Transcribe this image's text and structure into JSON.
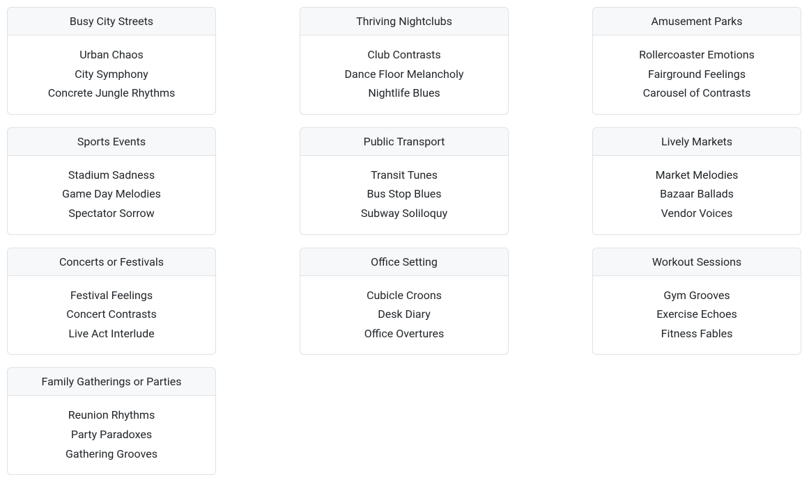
{
  "cards": [
    {
      "title": "Busy City Streets",
      "items": [
        "Urban Chaos",
        "City Symphony",
        "Concrete Jungle Rhythms"
      ]
    },
    {
      "title": "Thriving Nightclubs",
      "items": [
        "Club Contrasts",
        "Dance Floor Melancholy",
        "Nightlife Blues"
      ]
    },
    {
      "title": "Amusement Parks",
      "items": [
        "Rollercoaster Emotions",
        "Fairground Feelings",
        "Carousel of Contrasts"
      ]
    },
    {
      "title": "Sports Events",
      "items": [
        "Stadium Sadness",
        "Game Day Melodies",
        "Spectator Sorrow"
      ]
    },
    {
      "title": "Public Transport",
      "items": [
        "Transit Tunes",
        "Bus Stop Blues",
        "Subway Soliloquy"
      ]
    },
    {
      "title": "Lively Markets",
      "items": [
        "Market Melodies",
        "Bazaar Ballads",
        "Vendor Voices"
      ]
    },
    {
      "title": "Concerts or Festivals",
      "items": [
        "Festival Feelings",
        "Concert Contrasts",
        "Live Act Interlude"
      ]
    },
    {
      "title": "Office Setting",
      "items": [
        "Cubicle Croons",
        "Desk Diary",
        "Office Overtures"
      ]
    },
    {
      "title": "Workout Sessions",
      "items": [
        "Gym Grooves",
        "Exercise Echoes",
        "Fitness Fables"
      ]
    },
    {
      "title": "Family Gatherings or Parties",
      "items": [
        "Reunion Rhythms",
        "Party Paradoxes",
        "Gathering Grooves"
      ]
    }
  ]
}
